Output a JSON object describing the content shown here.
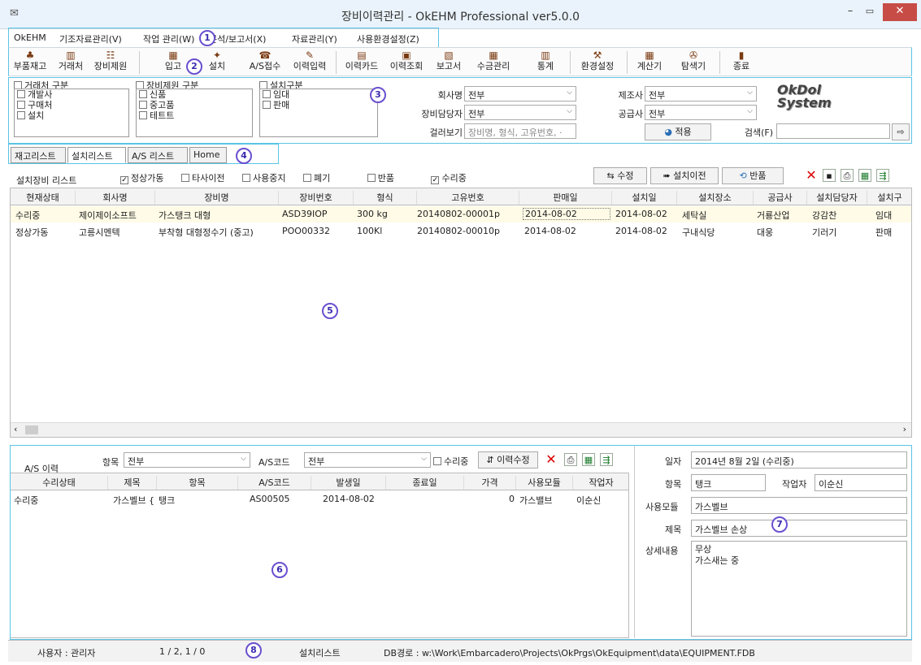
{
  "window": {
    "title": "장비이력관리 - OkEHM Professional ver5.0.0"
  },
  "menu": [
    "OkEHM",
    "기조자료관리(V)",
    "작업 관리(W)",
    "분석/보고서(X)",
    "자료관리(Y)",
    "사용환경설정(Z)"
  ],
  "toolbar": [
    {
      "label": "부품재고",
      "icon": "parts-icon"
    },
    {
      "label": "거래처",
      "icon": "client-icon"
    },
    {
      "label": "장비제원",
      "icon": "equipment-spec-icon"
    },
    {
      "label": "입고",
      "icon": "stock-in-icon"
    },
    {
      "label": "설치",
      "icon": "install-icon"
    },
    {
      "label": "A/S접수",
      "icon": "service-call-icon"
    },
    {
      "label": "이력입력",
      "icon": "history-input-icon"
    },
    {
      "label": "이력카드",
      "icon": "history-card-icon"
    },
    {
      "label": "이력조회",
      "icon": "history-search-icon"
    },
    {
      "label": "보고서",
      "icon": "report-icon"
    },
    {
      "label": "수금관리",
      "icon": "collection-icon"
    },
    {
      "label": "통계",
      "icon": "stats-icon"
    },
    {
      "label": "환경설정",
      "icon": "settings-icon"
    },
    {
      "label": "계산기",
      "icon": "calculator-icon"
    },
    {
      "label": "탐색기",
      "icon": "explorer-icon"
    },
    {
      "label": "종료",
      "icon": "exit-icon"
    }
  ],
  "filters": {
    "client_group": {
      "title": "거래처 구분",
      "items": [
        "개발사",
        "구매처",
        "설치"
      ]
    },
    "spec_group": {
      "title": "장비제원 구분",
      "items": [
        "신품",
        "중고품",
        "테트트"
      ]
    },
    "install_group": {
      "title": "설치구분",
      "items": [
        "임대",
        "판매"
      ]
    },
    "company_label": "회사명",
    "company_value": "전부",
    "manager_label": "장비담당자",
    "manager_value": "전부",
    "filter_label": "걸러보기",
    "filter_placeholder": "장비명, 형식, 고유번호, ·",
    "maker_label": "제조사",
    "maker_value": "전부",
    "supplier_label": "공급사",
    "supplier_value": "전부",
    "apply_label": "적용",
    "search_label": "검색(F)",
    "logo_line1": "OkDol",
    "logo_line2": "System"
  },
  "tabs": [
    "재고리스트",
    "설치리스트",
    "A/S 리스트",
    "Home"
  ],
  "install_list": {
    "title": "설치장비 리스트",
    "status_filters": [
      {
        "label": "정상가동",
        "checked": true
      },
      {
        "label": "타사이전",
        "checked": false
      },
      {
        "label": "사용중지",
        "checked": false
      },
      {
        "label": "폐기",
        "checked": false
      },
      {
        "label": "반품",
        "checked": false
      },
      {
        "label": "수리중",
        "checked": true
      }
    ],
    "edit_label": "수정",
    "move_label": "설치이전",
    "return_label": "반품",
    "columns": [
      "현재상태",
      "회사명",
      "장비명",
      "장비번호",
      "형식",
      "고유번호",
      "판매일",
      "설치일",
      "설치장소",
      "공급사",
      "설치담당자",
      "설치구"
    ],
    "rows": [
      [
        "수리중",
        "제이제이소프트",
        "가스탱크 대형",
        "ASD39IOP",
        "300 kg",
        "20140802-00001p",
        "2014-08-02",
        "2014-08-02",
        "세탁실",
        "거룡산업",
        "강감찬",
        "임대"
      ],
      [
        "정상가동",
        "고릉시멘텍",
        "부착형 대형정수기 (중고)",
        "POO00332",
        "100Kl",
        "20140802-00010p",
        "2014-08-02",
        "2014-08-02",
        "구내식당",
        "대웅",
        "기러기",
        "판매"
      ]
    ]
  },
  "as_history": {
    "title": "A/S 이력",
    "item_label": "항목",
    "item_value": "전부",
    "code_label": "A/S코드",
    "code_value": "전부",
    "repair_label": "수리중",
    "edit_label": "이력수정",
    "columns": [
      "수리상태",
      "제목",
      "항목",
      "A/S코드",
      "발생일",
      "종료일",
      "가격",
      "사용모듈",
      "작업자"
    ],
    "rows": [
      [
        "수리중",
        "가스벨브 {",
        "탱크",
        "AS00505",
        "2014-08-02",
        "",
        "0",
        "가스밸브",
        "이순신"
      ]
    ]
  },
  "detail": {
    "date_label": "일자",
    "date_value": "2014년 8월 2일 (수리중)",
    "item_label": "항목",
    "item_value": "탱크",
    "worker_label": "작업자",
    "worker_value": "이순신",
    "module_label": "사용모듈",
    "module_value": "가스벨브",
    "subject_label": "제목",
    "subject_value": "가스벨브 손상",
    "content_label": "상세내용",
    "content_line1": "무상",
    "content_line2": "가스새는 중"
  },
  "status": {
    "user": "사용자 : 관리자",
    "count": "1 / 2, 1 / 0",
    "view": "설치리스트",
    "db_path": "DB경로 : w:\\Work\\Embarcadero\\Projects\\OkPrgs\\OkEquipment\\data\\EQUIPMENT.FDB"
  },
  "callouts": [
    "1",
    "2",
    "3",
    "4",
    "5",
    "6",
    "7",
    "8"
  ]
}
